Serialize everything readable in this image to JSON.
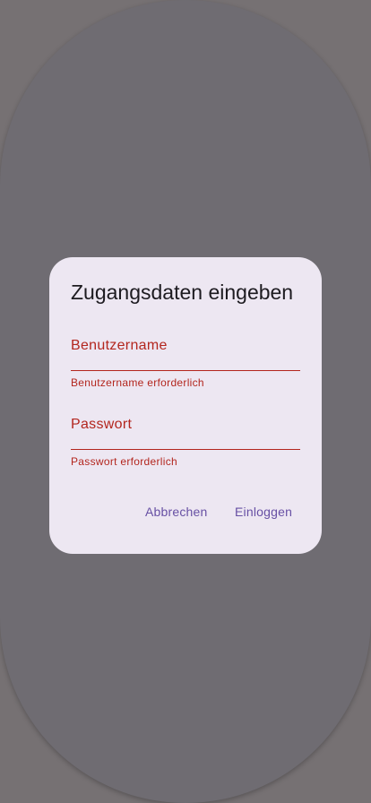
{
  "dialog": {
    "title": "Zugangsdaten eingeben",
    "username": {
      "label": "Benutzername",
      "value": "",
      "error": "Benutzername erforderlich"
    },
    "password": {
      "label": "Passwort",
      "value": "",
      "error": "Passwort erforderlich"
    },
    "actions": {
      "cancel_label": "Abbrechen",
      "login_label": "Einloggen"
    }
  },
  "colors": {
    "scrim": "#767173",
    "surface": "#ede7f2",
    "error": "#b3261e",
    "primary": "#6750a4",
    "on_surface": "#1d1b20"
  }
}
